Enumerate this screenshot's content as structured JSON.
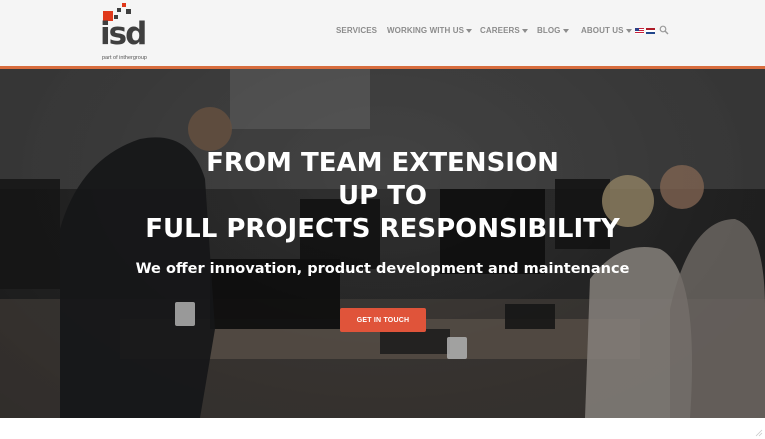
{
  "header": {
    "logo": {
      "wordmark": "isd",
      "tagline": "part of inthergroup",
      "square_colors": [
        "#e0391b",
        "#3f3f3f"
      ]
    },
    "nav": [
      {
        "label": "SERVICES",
        "has_dropdown": false
      },
      {
        "label": "WORKING WITH US",
        "has_dropdown": true
      },
      {
        "label": "CAREERS",
        "has_dropdown": true
      },
      {
        "label": "BLOG",
        "has_dropdown": true
      },
      {
        "label": "ABOUT US",
        "has_dropdown": true
      }
    ],
    "languages": [
      "us-flag-icon",
      "nl-flag-icon"
    ],
    "search_icon": "search-icon",
    "accent_rule_color": "#d86d3e"
  },
  "hero": {
    "title_lines": [
      "FROM TEAM EXTENSION",
      "UP TO",
      "FULL PROJECTS RESPONSIBILITY"
    ],
    "subtitle": "We offer innovation, product development and maintenance",
    "cta_label": "GET IN TOUCH",
    "cta_color": "#e0543a"
  }
}
